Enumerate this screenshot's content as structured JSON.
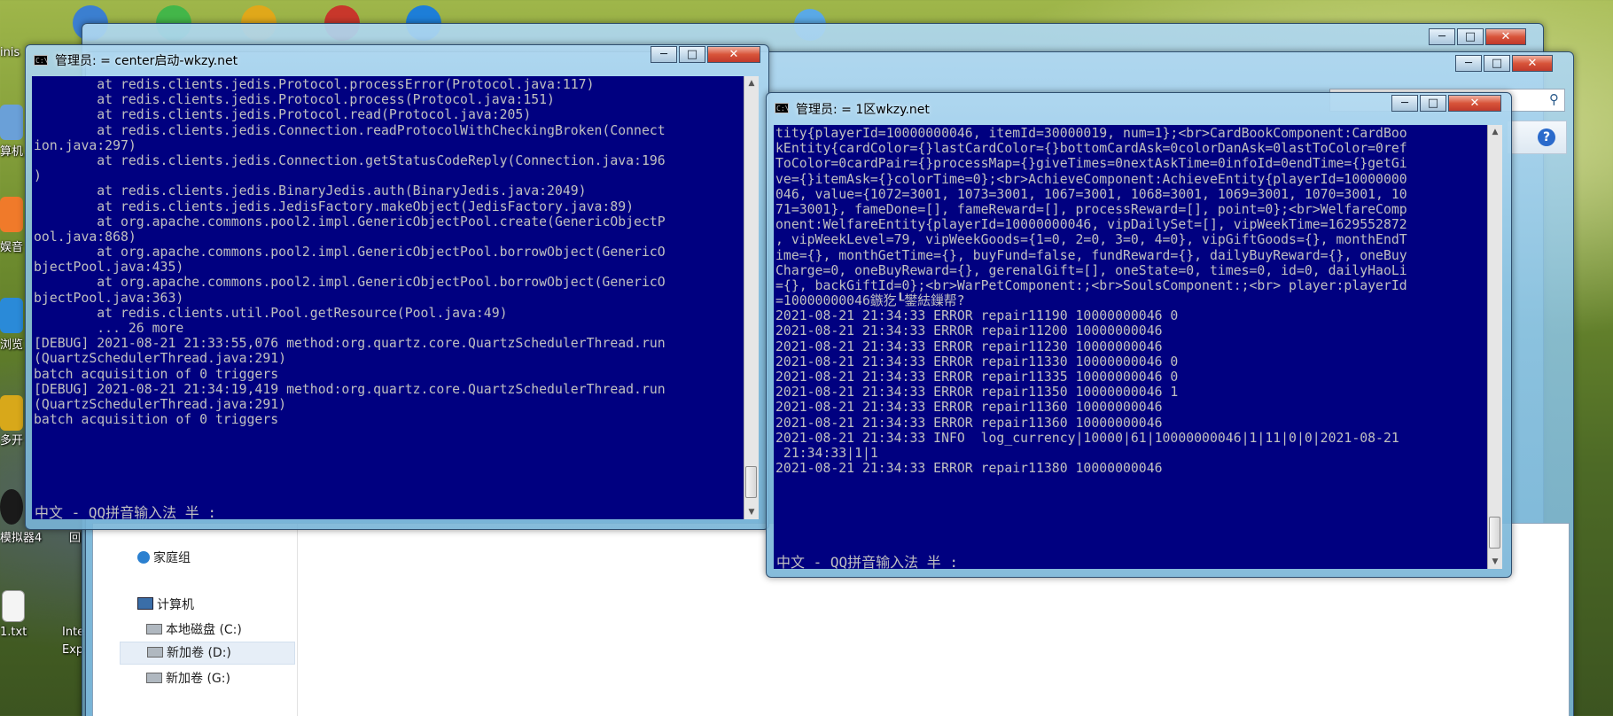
{
  "desktop": {
    "left_labels": [
      "inis",
      "算机",
      "娱音",
      "浏览",
      "多开",
      "模拟器4",
      "回",
      "1.txt",
      "Inte",
      "Exp"
    ]
  },
  "center_window": {
    "title": "管理员: = center启动-wkzy.net",
    "lines": [
      "        at redis.clients.jedis.Protocol.processError(Protocol.java:117)",
      "        at redis.clients.jedis.Protocol.process(Protocol.java:151)",
      "        at redis.clients.jedis.Protocol.read(Protocol.java:205)",
      "        at redis.clients.jedis.Connection.readProtocolWithCheckingBroken(Connect",
      "ion.java:297)",
      "        at redis.clients.jedis.Connection.getStatusCodeReply(Connection.java:196",
      ")",
      "        at redis.clients.jedis.BinaryJedis.auth(BinaryJedis.java:2049)",
      "        at redis.clients.jedis.JedisFactory.makeObject(JedisFactory.java:89)",
      "        at org.apache.commons.pool2.impl.GenericObjectPool.create(GenericObjectP",
      "ool.java:868)",
      "        at org.apache.commons.pool2.impl.GenericObjectPool.borrowObject(GenericO",
      "bjectPool.java:435)",
      "        at org.apache.commons.pool2.impl.GenericObjectPool.borrowObject(GenericO",
      "bjectPool.java:363)",
      "        at redis.clients.util.Pool.getResource(Pool.java:49)",
      "        ... 26 more",
      "[DEBUG] 2021-08-21 21:33:55,076 method:org.quartz.core.QuartzSchedulerThread.run",
      "(QuartzSchedulerThread.java:291)",
      "batch acquisition of 0 triggers",
      "[DEBUG] 2021-08-21 21:34:19,419 method:org.quartz.core.QuartzSchedulerThread.run",
      "(QuartzSchedulerThread.java:291)",
      "batch acquisition of 0 triggers"
    ],
    "ime_status": "中文 - QQ拼音输入法 半 :"
  },
  "zone_window": {
    "title": "管理员: = 1区wkzy.net",
    "lines": [
      "tity{playerId=10000000046, itemId=30000019, num=1};<br>CardBookComponent:CardBoo",
      "kEntity{cardColor={}lastCardColor={}bottomCardAsk=0colorDanAsk=0lastToColor=0ref",
      "ToColor=0cardPair={}processMap={}giveTimes=0nextAskTime=0infoId=0endTime={}getGi",
      "ve={}itemAsk={}colorTime=0};<br>AchieveComponent:AchieveEntity{playerId=10000000",
      "046, value={1072=3001, 1073=3001, 1067=3001, 1068=3001, 1069=3001, 1070=3001, 10",
      "71=3001}, fameDone=[], fameReward=[], processReward=[], point=0};<br>WelfareComp",
      "onent:WelfareEntity{playerId=10000000046, vipDailySet=[], vipWeekTime=1629552872",
      ", vipWeekLevel=79, vipWeekGoods={1=0, 2=0, 3=0, 4=0}, vipGiftGoods={}, monthEndT",
      "ime={}, monthGetTime={}, buyFund=false, fundReward={}, dailyBuyReward={}, oneBuy",
      "Charge=0, oneBuyReward={}, gerenalGift=[], oneState=0, times=0, id=0, dailyHaoLi",
      "={}, backGiftId=0};<br>WarPetComponent:;<br>SoulsComponent:;<br> player:playerId",
      "=10000000046鏃犵┖鐢紶鏁帮?",
      "2021-08-21 21:34:33 ERROR repair11190 10000000046 0",
      "2021-08-21 21:34:33 ERROR repair11200 10000000046",
      "2021-08-21 21:34:33 ERROR repair11230 10000000046",
      "2021-08-21 21:34:33 ERROR repair11330 10000000046 0",
      "2021-08-21 21:34:33 ERROR repair11335 10000000046 0",
      "2021-08-21 21:34:33 ERROR repair11350 10000000046 1",
      "2021-08-21 21:34:33 ERROR repair11360 10000000046",
      "2021-08-21 21:34:33 ERROR repair11360 10000000046",
      "2021-08-21 21:34:33 INFO  log_currency|10000|61|10000000046|1|11|0|0|2021-08-21",
      " 21:34:33|1|1",
      "2021-08-21 21:34:33 ERROR repair11380 10000000046"
    ],
    "ime_status": "中文 - QQ拼音输入法 半 :"
  },
  "explorer": {
    "nav_items": [
      {
        "label": "家庭组",
        "icon": "homegroup-icon"
      },
      {
        "label": "计算机",
        "icon": "computer-icon"
      },
      {
        "label": "本地磁盘 (C:)",
        "icon": "drive-icon"
      },
      {
        "label": "新加卷 (D:)",
        "icon": "drive-icon"
      },
      {
        "label": "新加卷 (G:)",
        "icon": "drive-icon"
      }
    ]
  },
  "colors": {
    "console_bg": "#000080",
    "console_fg": "#c0c0c0"
  }
}
